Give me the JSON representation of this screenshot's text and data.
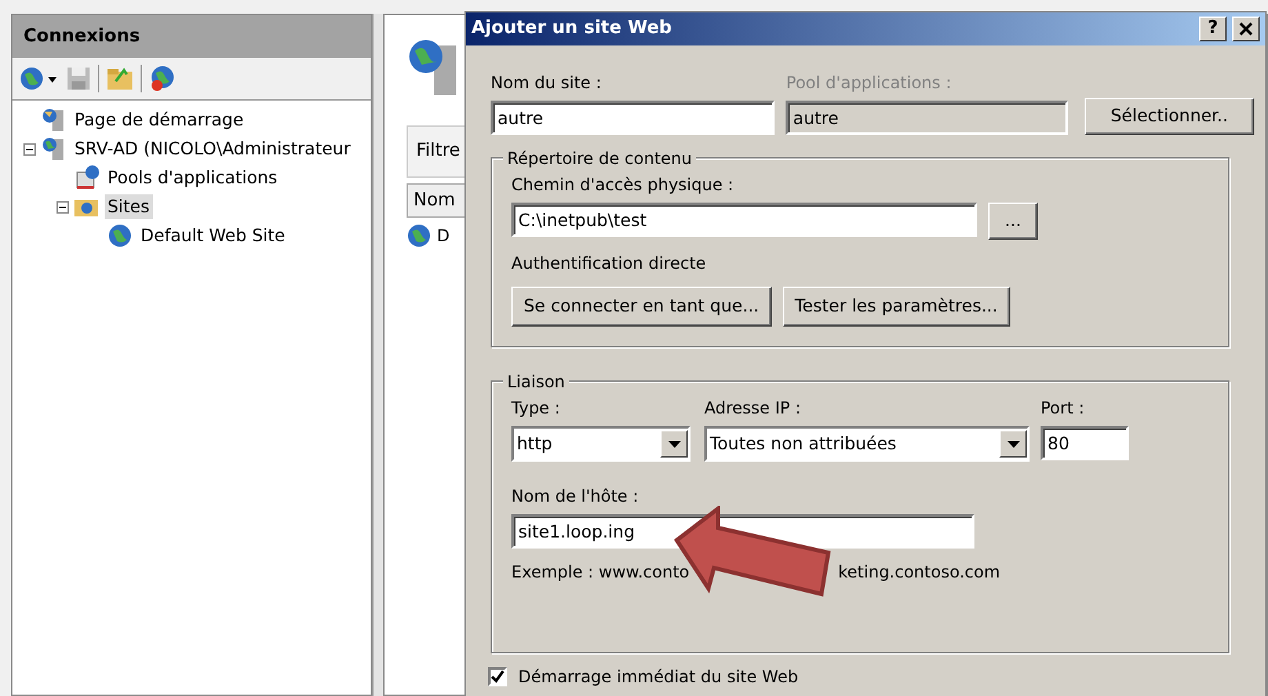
{
  "connections": {
    "title": "Connexions",
    "tree": [
      {
        "label": "Page de démarrage",
        "kind": "start",
        "selected": false
      },
      {
        "label": "SRV-AD (NICOLO\\Administrateur",
        "kind": "server",
        "selected": false,
        "expanded": true,
        "children": [
          {
            "label": "Pools d'applications",
            "kind": "pool",
            "selected": false
          },
          {
            "label": "Sites",
            "kind": "sites",
            "selected": true,
            "expanded": true,
            "children": [
              {
                "label": "Default Web Site",
                "kind": "site",
                "selected": false
              }
            ]
          }
        ]
      }
    ]
  },
  "content": {
    "tab": "Filtre",
    "column": "Nom",
    "rows": [
      "D"
    ]
  },
  "dialog": {
    "title": "Ajouter un site Web",
    "help": "?",
    "site_name": {
      "label": "Nom du site :",
      "value": "autre"
    },
    "app_pool": {
      "label": "Pool d'applications :",
      "value": "autre",
      "disabled": true
    },
    "select_button": "Sélectionner..",
    "content_dir": {
      "legend": "Répertoire de contenu",
      "path_label": "Chemin d'accès physique :",
      "path_value": "C:\\inetpub\\test",
      "browse": "...",
      "auth": "Authentification directe",
      "buttons": [
        "Se connecter en tant que...",
        "Tester les paramètres..."
      ]
    },
    "binding": {
      "legend": "Liaison",
      "type_label": "Type :",
      "type_value": "http",
      "ip_label": "Adresse IP :",
      "ip_value": "Toutes non attribuées",
      "port_label": "Port :",
      "port_value": "80",
      "host_label": "Nom de l'hôte :",
      "host_value": "site1.loop.ing",
      "example": [
        "Exemple : www.conto",
        "keting.contoso.com"
      ]
    },
    "start_now": {
      "label": "Démarrage immédiat du site Web",
      "checked": true
    }
  }
}
